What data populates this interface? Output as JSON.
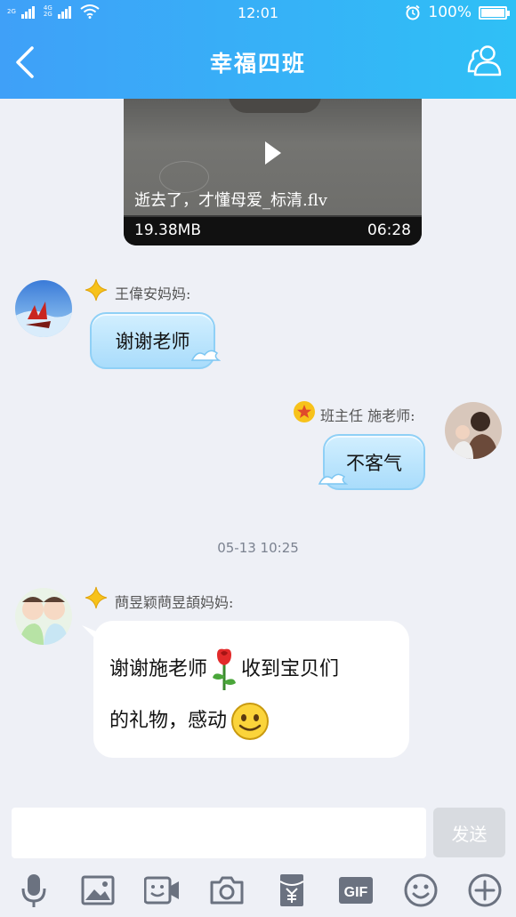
{
  "status_bar": {
    "sim1_label_top": "2G",
    "sim2_label_top": "4G",
    "sim2_label_bottom": "2G",
    "time": "12:01",
    "battery": "100%"
  },
  "header": {
    "title": "幸福四班",
    "back_icon": "chevron-left-icon",
    "members_icon": "group-members-icon"
  },
  "video": {
    "filename": "逝去了，才懂母爱_标清.flv",
    "size": "19.38MB",
    "duration": "06:28"
  },
  "messages": [
    {
      "sender": "王偉安妈妈:",
      "text": "谢谢老师",
      "side": "left"
    },
    {
      "sender": "班主任 施老师:",
      "text": "不客气",
      "side": "right"
    }
  ],
  "timestamp": "05-13 10:25",
  "long_message": {
    "sender": "蔄昱颖蔄昱頡妈妈:",
    "line1_a": "谢谢施老师",
    "line1_b": "收到宝贝们",
    "line2": "的礼物，感动"
  },
  "input": {
    "placeholder": "",
    "send_label": "发送"
  },
  "toolbar": {
    "gif_label": "GIF",
    "icons": [
      "microphone-icon",
      "image-icon",
      "video-icon",
      "camera-icon",
      "red-packet-icon",
      "gif-icon",
      "emoji-icon",
      "plus-icon"
    ]
  },
  "colors": {
    "header_start": "#3fa0f8",
    "header_end": "#2fc0f6",
    "background": "#eef0f6",
    "bubble_blue": "#a9dcfb",
    "badge_gold": "#f7c21b",
    "icon_gray": "#6b7280"
  }
}
